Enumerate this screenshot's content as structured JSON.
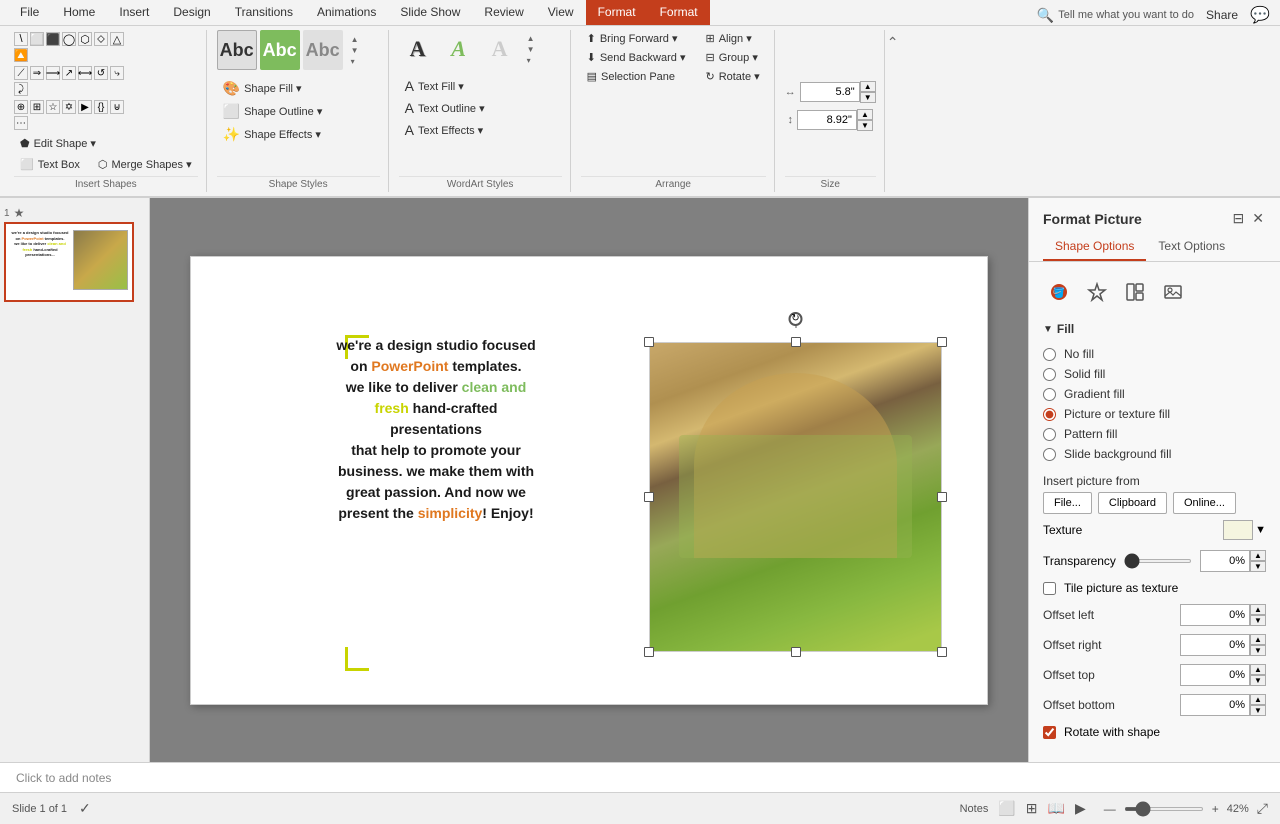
{
  "tabs": [
    {
      "id": "file",
      "label": "File"
    },
    {
      "id": "home",
      "label": "Home"
    },
    {
      "id": "insert",
      "label": "Insert"
    },
    {
      "id": "design",
      "label": "Design"
    },
    {
      "id": "transitions",
      "label": "Transitions"
    },
    {
      "id": "animations",
      "label": "Animations"
    },
    {
      "id": "slideshow",
      "label": "Slide Show"
    },
    {
      "id": "review",
      "label": "Review"
    },
    {
      "id": "view",
      "label": "View"
    },
    {
      "id": "format1",
      "label": "Format"
    },
    {
      "id": "format2",
      "label": "Format"
    }
  ],
  "search_placeholder": "Tell me what you want to do",
  "ribbon": {
    "insert_shapes": {
      "label": "Insert Shapes",
      "edit_shape": "Edit Shape ▾",
      "text_box": "Text Box",
      "merge_shapes": "Merge Shapes ▾"
    },
    "shape_styles": {
      "label": "Shape Styles",
      "shape_fill": "Shape Fill ▾",
      "shape_outline": "Shape Outline ▾",
      "shape_effects": "Shape Effects ▾",
      "swatches": [
        "Abc",
        "Abc",
        "Abc"
      ]
    },
    "wordart_styles": {
      "label": "WordArt Styles",
      "text_fill": "Text Fill ▾",
      "text_outline": "Text Outline ▾",
      "text_effects": "Text Effects ▾",
      "letters": [
        "A",
        "A",
        "A"
      ]
    },
    "arrange": {
      "label": "Arrange",
      "bring_forward": "Bring Forward ▾",
      "send_backward": "Send Backward ▾",
      "selection_pane": "Selection Pane",
      "align": "Align ▾",
      "group": "Group ▾",
      "rotate": "Rotate ▾"
    },
    "size": {
      "label": "Size",
      "width": "5.8\"",
      "height": "8.92\""
    }
  },
  "format_panel": {
    "title": "Format Picture",
    "tab_shape": "Shape Options",
    "tab_text": "Text Options",
    "icons": [
      "fill-icon",
      "effects-icon",
      "layout-icon",
      "picture-icon"
    ],
    "section_fill": "Fill",
    "fill_options": [
      {
        "id": "no_fill",
        "label": "No fill",
        "checked": false
      },
      {
        "id": "solid_fill",
        "label": "Solid fill",
        "checked": false
      },
      {
        "id": "gradient_fill",
        "label": "Gradient fill",
        "checked": false
      },
      {
        "id": "picture_texture",
        "label": "Picture or texture fill",
        "checked": true
      },
      {
        "id": "pattern_fill",
        "label": "Pattern fill",
        "checked": false
      },
      {
        "id": "slide_background",
        "label": "Slide background fill",
        "checked": false
      }
    ],
    "insert_picture_from": "Insert picture from",
    "insert_btns": [
      "File...",
      "Clipboard",
      "Online..."
    ],
    "texture_label": "Texture",
    "transparency_label": "Transparency",
    "transparency_value": "0%",
    "tile_label": "Tile picture as texture",
    "tile_checked": false,
    "offset_left_label": "Offset left",
    "offset_left_value": "0%",
    "offset_right_label": "Offset right",
    "offset_right_value": "0%",
    "offset_top_label": "Offset top",
    "offset_top_value": "0%",
    "offset_bottom_label": "Offset bottom",
    "offset_bottom_value": "0%",
    "rotate_label": "Rotate with shape",
    "rotate_checked": true
  },
  "slide": {
    "number": "1",
    "text_lines": [
      "we're a design studio focused",
      "on ",
      "PowerPoint",
      " templates.",
      "we like to deliver ",
      "clean and",
      "fresh",
      " hand-crafted",
      "presentations",
      "that help to promote your",
      "business. we make them with",
      "great passion. And now we",
      "present the ",
      "simplicity",
      "! Enjoy!"
    ]
  },
  "status_bar": {
    "slide_info": "Slide 1 of 1",
    "notes": "Notes",
    "zoom": "42%"
  },
  "notes_placeholder": "Click to add notes",
  "share_label": "Share"
}
